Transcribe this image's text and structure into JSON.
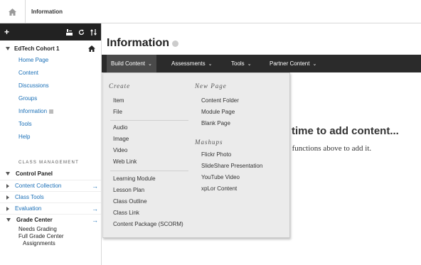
{
  "breadcrumb": {
    "current": "Information"
  },
  "course": {
    "title": "EdTech Cohort 1",
    "nav": [
      {
        "label": "Home Page"
      },
      {
        "label": "Content"
      },
      {
        "label": "Discussions"
      },
      {
        "label": "Groups"
      },
      {
        "label": "Information"
      },
      {
        "label": "Tools"
      },
      {
        "label": "Help"
      }
    ]
  },
  "class_management": {
    "label": "CLASS MANAGEMENT",
    "control_panel": "Control Panel",
    "items": [
      {
        "label": "Content Collection"
      },
      {
        "label": "Class Tools"
      },
      {
        "label": "Evaluation"
      },
      {
        "label": "Grade Center"
      }
    ],
    "grade_center_sub": [
      "Needs Grading",
      "Full Grade Center",
      "Assignments"
    ]
  },
  "page": {
    "title": "Information"
  },
  "action_bar": {
    "buttons": [
      {
        "label": "Build Content",
        "caret": "⌄"
      },
      {
        "label": "Assessments",
        "caret": "⌄"
      },
      {
        "label": "Tools",
        "caret": "⌄"
      },
      {
        "label": "Partner Content",
        "caret": "⌄"
      }
    ]
  },
  "build_menu": {
    "create": {
      "heading": "Create",
      "items": [
        "Item",
        "File",
        "Audio",
        "Image",
        "Video",
        "Web Link",
        "Learning Module",
        "Lesson Plan",
        "Class Outline",
        "Class Link",
        "Content Package (SCORM)"
      ]
    },
    "new_page": {
      "heading": "New Page",
      "items": [
        "Content Folder",
        "Module Page",
        "Blank Page"
      ]
    },
    "mashups": {
      "heading": "Mashups",
      "items": [
        "Flickr Photo",
        "SlideShare Presentation",
        "YouTube Video",
        "xpLor Content"
      ]
    }
  },
  "background": {
    "line1": "time to add content...",
    "line2": "e functions above to add it."
  },
  "colors": {
    "link": "#1a6fb7",
    "action_bar": "#2b2b2b",
    "dropdown_bg": "#ebebeb"
  }
}
